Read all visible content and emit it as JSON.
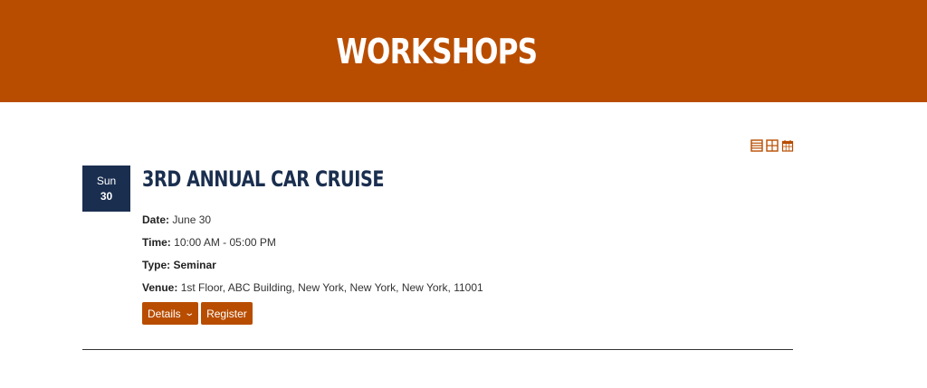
{
  "header": {
    "title": "WORKSHOPS",
    "background_color": "#b84d00"
  },
  "view_switcher": {
    "icons": [
      "list-view-icon",
      "grid-view-icon",
      "calendar-view-icon"
    ],
    "color": "#b84d00"
  },
  "event": {
    "badge": {
      "day": "Sun",
      "date": "30",
      "color": "#1a2e4f"
    },
    "title": "3RD ANNUAL CAR CRUISE",
    "date_label": "Date:",
    "date_value": "June 30",
    "time_label": "Time:",
    "time_value": "10:00 AM - 05:00 PM",
    "type_label": "Type:",
    "type_value": "Seminar",
    "venue_label": "Venue:",
    "venue_value": "1st Floor, ABC Building, New York, New York, New York, 11001",
    "details_label": "Details",
    "register_label": "Register"
  }
}
